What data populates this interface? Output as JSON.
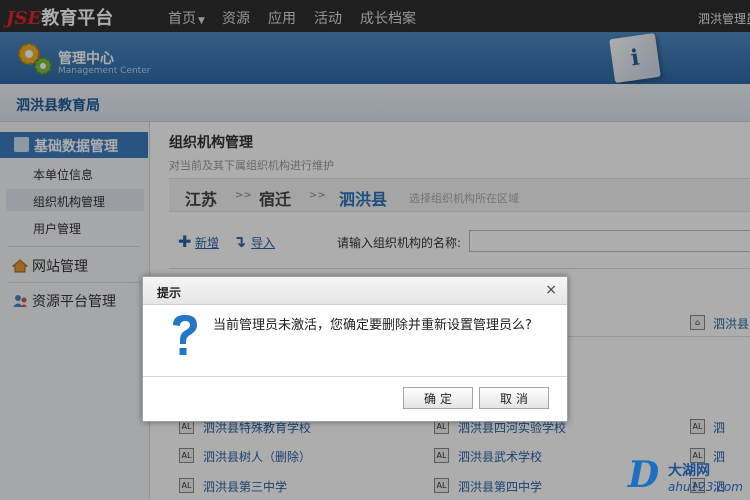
{
  "topnav": {
    "logo_brand": "JSE",
    "logo_text": "教育平台",
    "items": [
      "首页",
      "资源",
      "应用",
      "活动",
      "成长档案"
    ],
    "user": "泗洪管理员"
  },
  "banner": {
    "title": "管理中心",
    "subtitle": "Management Center",
    "info_glyph": "i"
  },
  "org": {
    "name": "泗洪县教育局"
  },
  "sidebar": {
    "header": "基础数据管理",
    "sub_items": [
      "本单位信息",
      "组织机构管理",
      "用户管理"
    ],
    "sections": [
      "网站管理",
      "资源平台管理"
    ]
  },
  "main": {
    "title": "组织机构管理",
    "description": "对当前及其下属组织机构进行维护",
    "crumbs": [
      "江苏",
      "宿迁",
      "泗洪县"
    ],
    "crumb_sep": ">>",
    "crumb_hint": "选择组织机构所在区域",
    "add_label": "新增",
    "import_label": "导入",
    "search_label": "请输入组织机构的名称:",
    "search_value": "",
    "right_item": "泗洪县",
    "grid": [
      [
        "泗洪县特殊教育学校",
        "泗洪县四河实验学校",
        "泗"
      ],
      [
        "泗洪县树人（删除）",
        "泗洪县武术学校",
        "泗"
      ],
      [
        "泗洪县第三中学",
        "泗洪县第四中学",
        "泗"
      ]
    ]
  },
  "dialog": {
    "title": "提示",
    "close": "×",
    "message": "当前管理员未激活，您确定要删除并重新设置管理员么?",
    "ok": "确定",
    "cancel": "取消"
  },
  "watermark": {
    "letter": "D",
    "name": "大湖网",
    "url": "ahu123.com"
  }
}
